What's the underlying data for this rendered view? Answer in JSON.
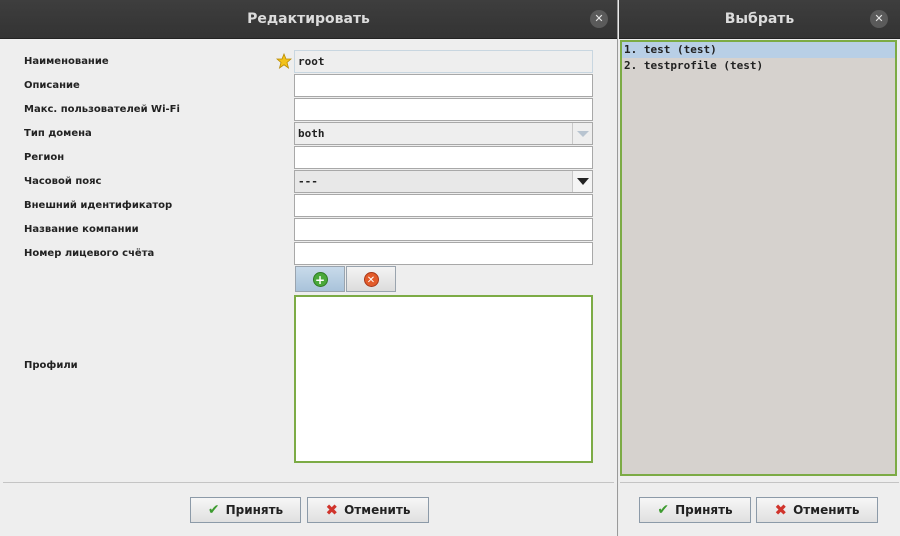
{
  "edit_window": {
    "title": "Редактировать",
    "fields": {
      "name": {
        "label": "Наименование",
        "value": "root"
      },
      "description": {
        "label": "Описание",
        "value": ""
      },
      "max_wifi_users": {
        "label": "Макс. пользователей Wi-Fi",
        "value": ""
      },
      "domain_type": {
        "label": "Тип домена",
        "value": "both"
      },
      "region": {
        "label": "Регион",
        "value": ""
      },
      "timezone": {
        "label": "Часовой пояс",
        "value": "---"
      },
      "external_id": {
        "label": "Внешний идентификатор",
        "value": ""
      },
      "company_name": {
        "label": "Название компании",
        "value": ""
      },
      "account_number": {
        "label": "Номер лицевого счёта",
        "value": ""
      },
      "profiles": {
        "label": "Профили"
      }
    },
    "accept_label": "Принять",
    "cancel_label": "Отменить"
  },
  "select_window": {
    "title": "Выбрать",
    "items": [
      "1. test (test)",
      "2. testprofile (test)"
    ],
    "accept_label": "Принять",
    "cancel_label": "Отменить"
  },
  "colors": {
    "titlebar": "#333333",
    "focus_border": "#7cab45",
    "selection": "#b8cfe6"
  }
}
